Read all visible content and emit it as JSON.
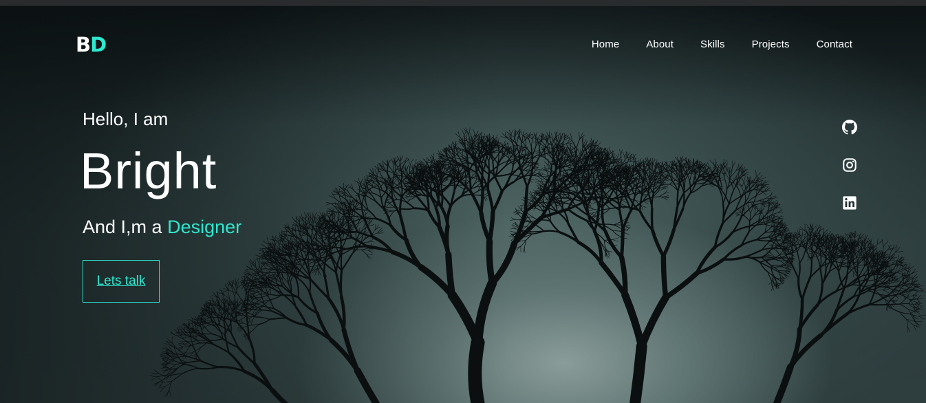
{
  "logo": {
    "first": "B",
    "second": "D"
  },
  "nav": {
    "items": [
      "Home",
      "About",
      "Skills",
      "Projects",
      "Contact"
    ]
  },
  "hero": {
    "greeting": "Hello, I am",
    "name": "Bright",
    "role_prefix": "And I,m a",
    "role_highlight": "Designer",
    "cta_label": "Lets talk"
  },
  "social": {
    "icons": [
      "github-icon",
      "instagram-icon",
      "linkedin-icon"
    ]
  },
  "colors": {
    "accent": "#2ee8cf",
    "text": "#ffffff",
    "background": "#223031"
  }
}
